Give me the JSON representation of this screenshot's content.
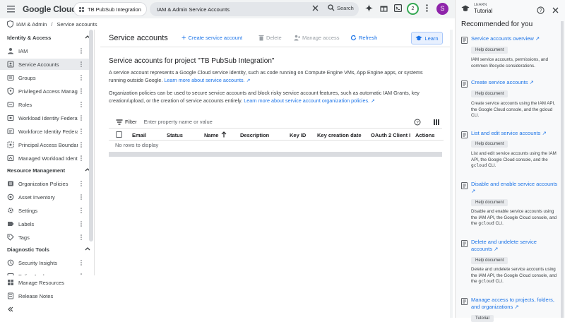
{
  "topbar": {
    "logo": "Google Cloud",
    "project_picker": "TB PubSub Integration",
    "search_value": "IAM & Admin Service Accounts",
    "search_button": "Search",
    "notifications_count": "2",
    "avatar_letter": "S",
    "colors": {
      "avatar": "#8e24aa",
      "ring": "#34a853"
    }
  },
  "breadcrumb": {
    "root": "IAM & Admin",
    "separator": "/",
    "current": "Service accounts"
  },
  "sidebar": {
    "sections": [
      {
        "title": "Identity & Access",
        "items": [
          {
            "label": "IAM",
            "icon": "person-icon"
          },
          {
            "label": "Service Accounts",
            "icon": "service-account-icon",
            "active": true
          },
          {
            "label": "Groups",
            "icon": "groups-icon"
          },
          {
            "label": "Privileged Access Manager",
            "icon": "shield-person-icon"
          },
          {
            "label": "Roles",
            "icon": "roles-icon"
          },
          {
            "label": "Workload Identity Federation",
            "icon": "federation-icon"
          },
          {
            "label": "Workforce Identity Federation",
            "icon": "workforce-icon"
          },
          {
            "label": "Principal Access Boundary",
            "icon": "boundary-icon"
          },
          {
            "label": "Managed Workload Identities",
            "icon": "workload-icon"
          }
        ]
      },
      {
        "title": "Resource Management",
        "items": [
          {
            "label": "Organization Policies",
            "icon": "policy-icon"
          },
          {
            "label": "Asset Inventory",
            "icon": "inventory-icon"
          },
          {
            "label": "Settings",
            "icon": "gear-icon"
          },
          {
            "label": "Labels",
            "icon": "label-icon"
          },
          {
            "label": "Tags",
            "icon": "tag-icon"
          }
        ]
      },
      {
        "title": "Diagnostic Tools",
        "items": [
          {
            "label": "Security Insights",
            "icon": "insights-icon"
          },
          {
            "label": "Policy Analyzer",
            "icon": "analyzer-icon"
          }
        ]
      }
    ],
    "footer": [
      {
        "label": "Manage Resources",
        "icon": "resources-icon"
      },
      {
        "label": "Release Notes",
        "icon": "notes-icon"
      }
    ]
  },
  "main": {
    "title": "Service accounts",
    "actions": {
      "create": "Create service account",
      "delete": "Delete",
      "manage_access": "Manage access",
      "refresh": "Refresh",
      "learn": "Learn"
    },
    "heading": "Service accounts for project \"TB PubSub Integration\"",
    "para1": "A service account represents a Google Cloud service identity, such as code running on Compute Engine VMs, App Engine apps, or systems running outside Google.",
    "para1_link": "Learn more about service accounts.",
    "para2": "Organization policies can be used to secure service accounts and block risky service account features, such as automatic IAM Grants, key creation/upload, or the creation of service accounts entirely.",
    "para2_link": "Learn more about service account organization policies.",
    "filter_label": "Filter",
    "filter_placeholder": "Enter property name or value",
    "columns": [
      "Email",
      "Status",
      "Name",
      "Description",
      "Key ID",
      "Key creation date",
      "OAuth 2 Client ID",
      "Actions"
    ],
    "empty_text": "No rows to display"
  },
  "panel": {
    "learn_label": "LEARN",
    "tutorial_label": "Tutorial",
    "recommended": "Recommended for you",
    "cards": [
      {
        "title": "Service accounts overview",
        "tag": "Help document",
        "desc": "IAM service accounts, permissions, and common lifecycle considerations."
      },
      {
        "title": "Create service accounts",
        "tag": "Help document",
        "desc": "Create service accounts using the IAM API, the Google Cloud console, and the gcloud CLI."
      },
      {
        "title": "List and edit service accounts",
        "tag": "Help document",
        "desc_a": "List and edit service accounts using the IAM API, the Google Cloud console, and the",
        "code": "gcloud",
        "desc_b": "CLI."
      },
      {
        "title": "Disable and enable service accounts",
        "tag": "Help document",
        "desc_a": "Disable and enable service accounts using the IAM API, the Google Cloud console, and the",
        "code": "gcloud",
        "desc_b": "CLI."
      },
      {
        "title": "Delete and undelete service accounts",
        "tag": "Help document",
        "desc_a": "Delete and undelete service accounts using the IAM API, the Google Cloud console, and the",
        "code": "gcloud",
        "desc_b": "CLI."
      },
      {
        "title": "Manage access to projects, folders, and organizations",
        "tag": "Tutorial"
      }
    ]
  }
}
